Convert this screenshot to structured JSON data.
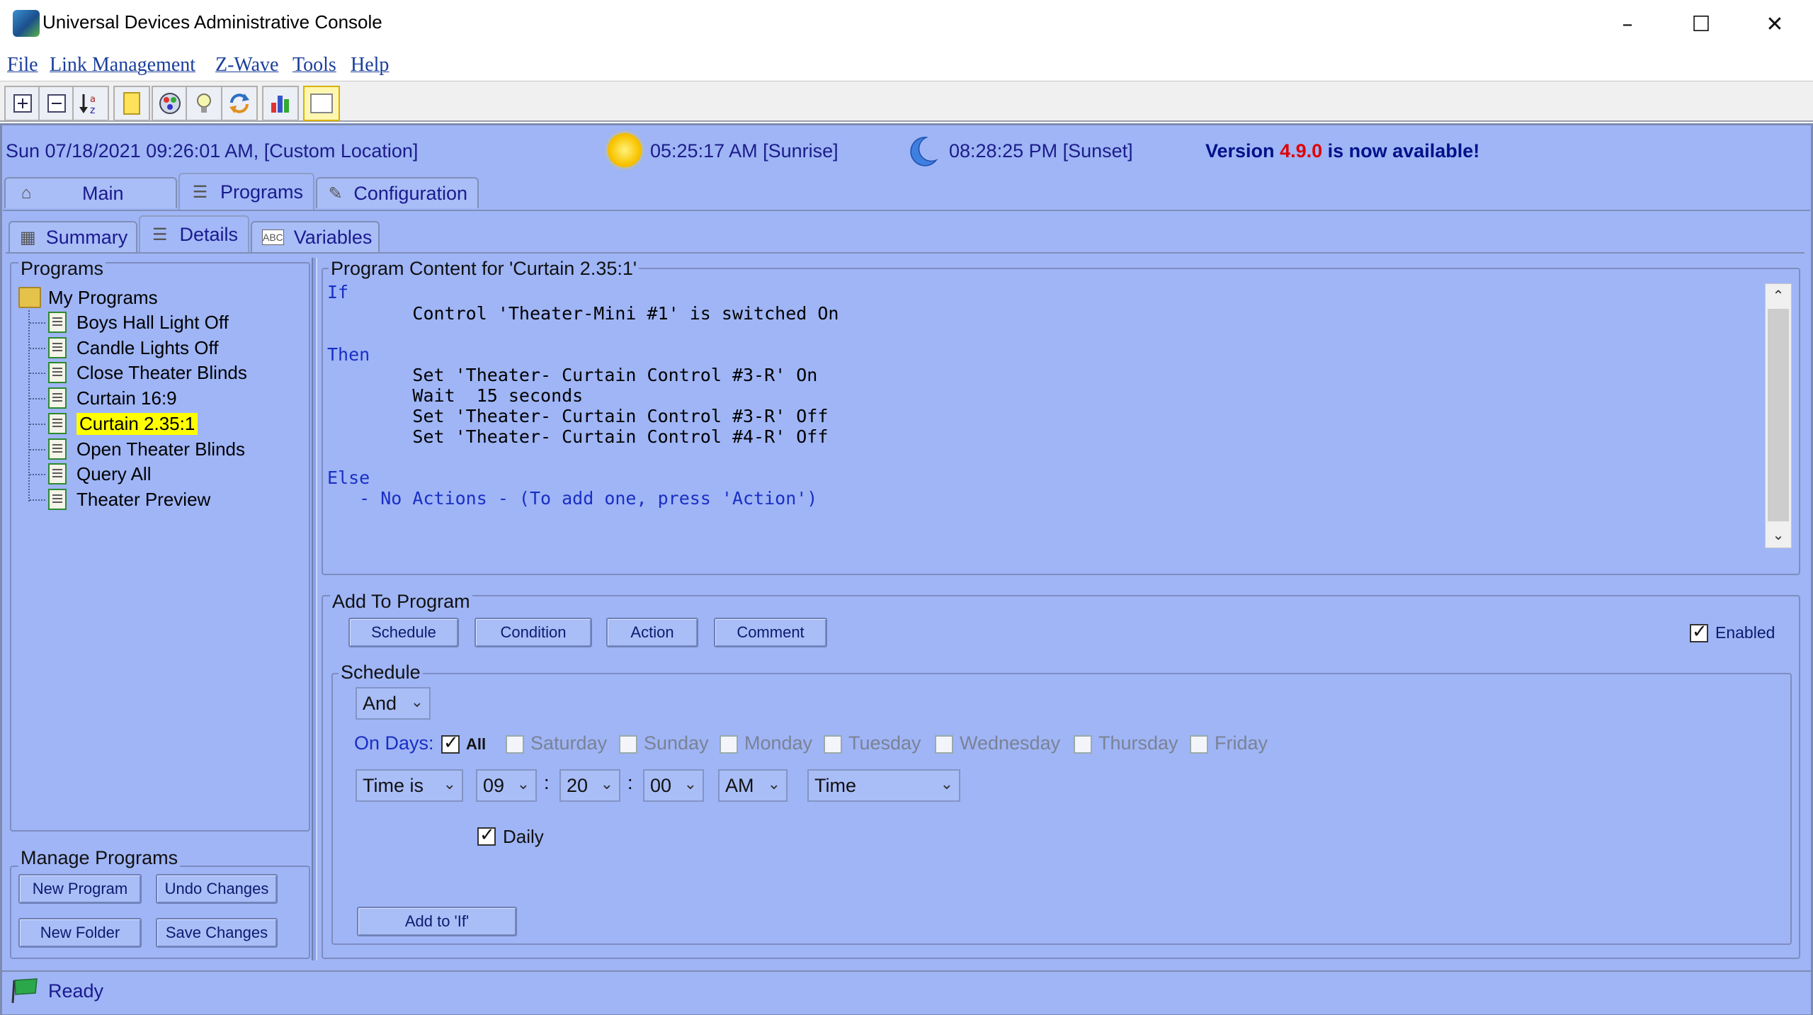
{
  "window": {
    "title": "Universal Devices Administrative Console",
    "minimize": "–",
    "maximize": "☐",
    "close": "✕"
  },
  "menu": [
    "File",
    "Link Management",
    "Z-Wave",
    "Tools",
    "Help"
  ],
  "toolbar": {
    "icons": [
      "expand-all-icon",
      "collapse-all-icon",
      "sort-az-icon",
      "note-icon",
      "scenes-icon",
      "lightbulb-icon",
      "refresh-icon",
      "chart-icon",
      "blank-panel-icon"
    ]
  },
  "info": {
    "datetime": "Sun 07/18/2021 09:26:01 AM,  [Custom Location]",
    "sunrise": "05:25:17 AM [Sunrise]",
    "sunset": "08:28:25 PM [Sunset]",
    "version_prefix": "Version",
    "version_number": "4.9.0",
    "version_suffix": "is now available!"
  },
  "tabs": {
    "main": "Main",
    "programs": "Programs",
    "configuration": "Configuration"
  },
  "subtabs": {
    "summary": "Summary",
    "details": "Details",
    "variables": "Variables",
    "variables_icon_text": "ABC"
  },
  "programs": {
    "label": "Programs",
    "folder": "My Programs",
    "items": [
      "Boys Hall Light Off",
      "Candle Lights Off",
      "Close Theater Blinds",
      "Curtain 16:9",
      "Curtain 2.35:1",
      "Open Theater Blinds",
      "Query All",
      "Theater Preview"
    ],
    "selected": "Curtain 2.35:1"
  },
  "manage": {
    "label": "Manage Programs",
    "new_program": "New Program",
    "undo_changes": "Undo Changes",
    "new_folder": "New Folder",
    "save_changes": "Save Changes"
  },
  "content": {
    "label": "Program Content for 'Curtain 2.35:1'",
    "if": "If",
    "if_line": "        Control 'Theater-Mini #1' is switched On",
    "then": "Then",
    "then_lines": [
      "        Set 'Theater- Curtain Control #3-R' On",
      "        Wait  15 seconds",
      "        Set 'Theater- Curtain Control #3-R' Off",
      "        Set 'Theater- Curtain Control #4-R' Off"
    ],
    "else": "Else",
    "else_line": "   - No Actions - (To add one, press 'Action')"
  },
  "add_to_program": {
    "label": "Add To Program",
    "schedule": "Schedule",
    "condition": "Condition",
    "action": "Action",
    "comment": "Comment",
    "enabled": "Enabled",
    "enabled_checked": true
  },
  "schedule": {
    "label": "Schedule",
    "logic": "And",
    "on_days_label": "On Days:",
    "all_label": "All",
    "days": [
      "Saturday",
      "Sunday",
      "Monday",
      "Tuesday",
      "Wednesday",
      "Thursday",
      "Friday"
    ],
    "time_mode": "Time is",
    "hour": "09",
    "minute": "20",
    "second": "00",
    "ampm": "AM",
    "time_type": "Time",
    "sep": ":",
    "daily": "Daily",
    "add_button": "Add to 'If'"
  },
  "status": {
    "text": "Ready"
  }
}
